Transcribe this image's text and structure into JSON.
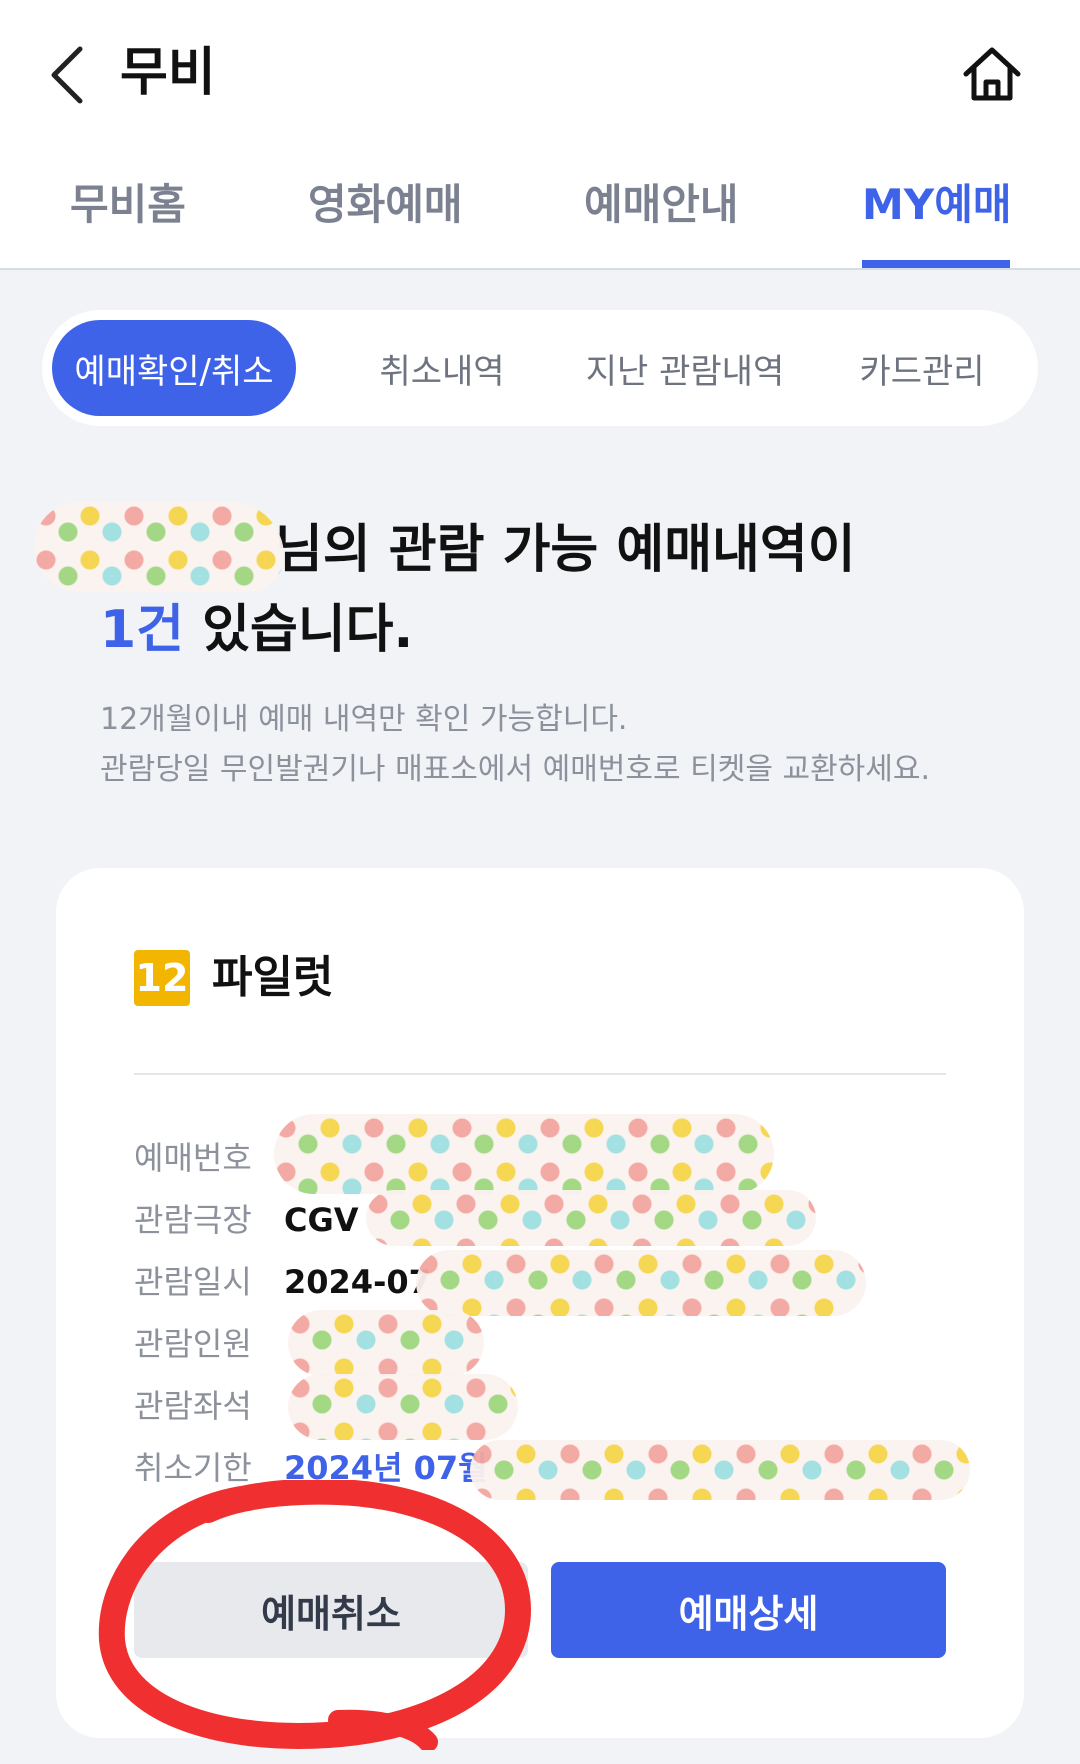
{
  "header": {
    "title": "무비",
    "tabs": [
      {
        "label": "무비홈",
        "active": false
      },
      {
        "label": "영화예매",
        "active": false
      },
      {
        "label": "예매안내",
        "active": false
      },
      {
        "label": "MY예매",
        "active": true
      }
    ]
  },
  "segment": {
    "items": [
      {
        "label": "예매확인/취소",
        "active": true
      },
      {
        "label": "취소내역",
        "active": false
      },
      {
        "label": "지난 관람내역",
        "active": false
      },
      {
        "label": "카드관리",
        "active": false
      }
    ]
  },
  "summary": {
    "line1_suffix": "님의 관람 가능 예매내역이",
    "count": "1건",
    "line2_suffix": " 있습니다.",
    "notice_line1": "12개월이내 예매 내역만 확인 가능합니다.",
    "notice_line2": "관람당일 무인발권기나 매표소에서 예매번호로 티켓을 교환하세요."
  },
  "ticket": {
    "rating": "12",
    "movie_title": "파일럿",
    "rows": [
      {
        "label": "예매번호",
        "value": ""
      },
      {
        "label": "관람극장",
        "value": "CGV"
      },
      {
        "label": "관람일시",
        "value": "2024-07"
      },
      {
        "label": "관람인원",
        "value": ""
      },
      {
        "label": "관람좌석",
        "value": ""
      },
      {
        "label": "취소기한",
        "value": "2024년 07월"
      }
    ],
    "cancel_button": "예매취소",
    "detail_button": "예매상세"
  },
  "colors": {
    "accent": "#3f63e8",
    "rating_badge": "#f2b600",
    "annotation": "#f03030"
  }
}
